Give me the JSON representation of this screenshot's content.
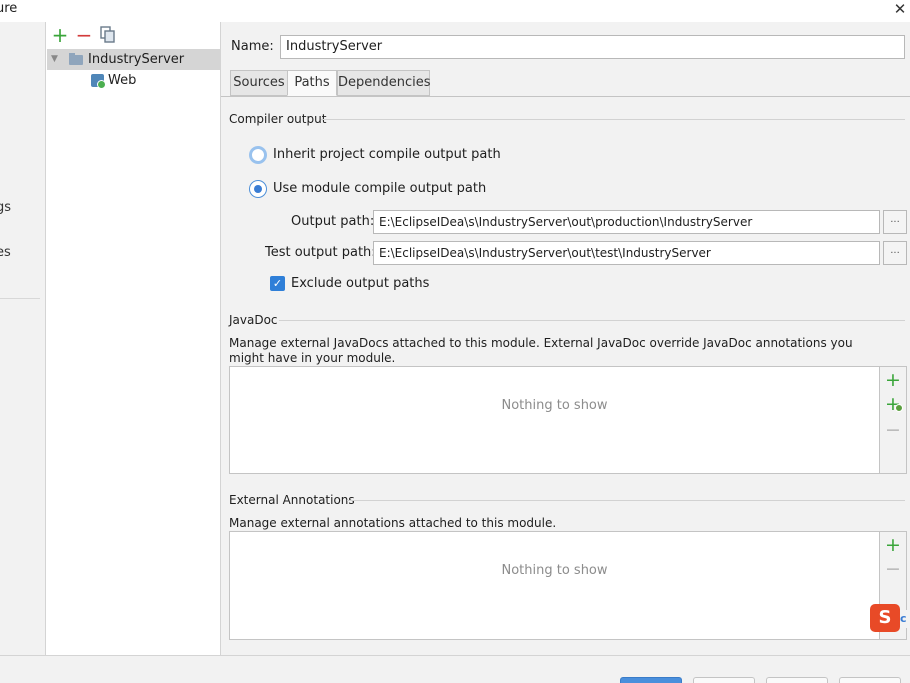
{
  "window": {
    "title_fragment": "ure",
    "close_glyph": "✕"
  },
  "left_clipped": {
    "items": [
      "gs",
      "es"
    ]
  },
  "tree": {
    "toolbar": {
      "add": "+",
      "remove": "−",
      "copy_icon": "copy-icon"
    },
    "nodes": [
      {
        "label": "IndustryServer",
        "icon": "module-folder-icon",
        "expanded": true,
        "selected": true
      },
      {
        "label": "Web",
        "icon": "web-facet-icon",
        "expanded": false,
        "selected": false
      }
    ]
  },
  "main": {
    "name_label": "Name:",
    "name_value": "IndustryServer",
    "tabs": [
      {
        "label": "Sources",
        "active": false
      },
      {
        "label": "Paths",
        "active": true
      },
      {
        "label": "Dependencies",
        "active": false
      }
    ],
    "compiler": {
      "title": "Compiler output",
      "inherit_label": "Inherit project compile output path",
      "use_module_label": "Use module compile output path",
      "output_path_label": "Output path:",
      "output_path_value": "E:\\EclipseIDea\\s\\IndustryServer\\out\\production\\IndustryServer",
      "test_path_label": "Test output path:",
      "test_path_value": "E:\\EclipseIDea\\s\\IndustryServer\\out\\test\\IndustryServer",
      "browse_label": "...",
      "exclude_label": "Exclude output paths",
      "exclude_checked": true
    },
    "javadoc": {
      "title": "JavaDoc",
      "description": "Manage external JavaDocs attached to this module. External JavaDoc override JavaDoc annotations you might have in your module.",
      "empty": "Nothing to show"
    },
    "annotations": {
      "title": "External Annotations",
      "description": "Manage external annotations attached to this module.",
      "empty": "Nothing to show"
    }
  },
  "ime": {
    "label": "S",
    "tail": "c"
  },
  "colors": {
    "accent": "#3a7dd4",
    "add_green": "#3aa53a",
    "remove_red": "#d33b3b",
    "panel_bg": "#f2f2f2"
  }
}
